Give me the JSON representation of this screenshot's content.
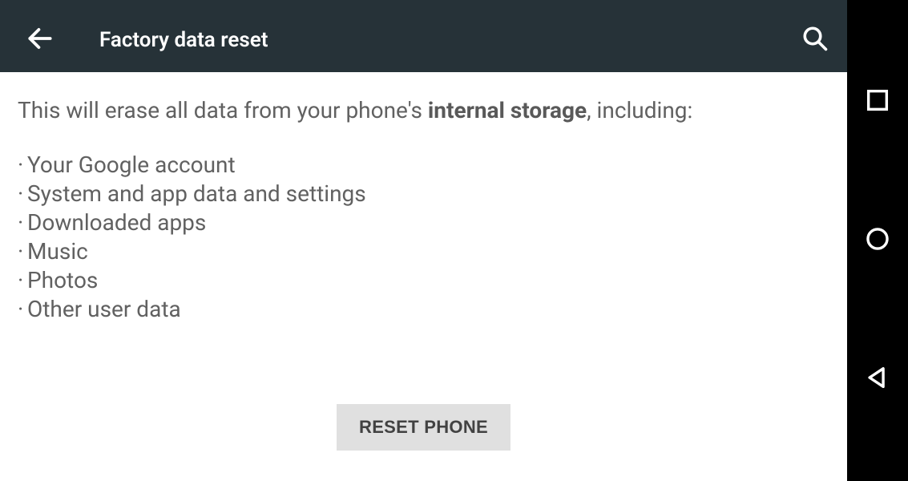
{
  "header": {
    "title": "Factory data reset"
  },
  "body": {
    "lead_pre": "This will erase all data from your phone's ",
    "lead_strong": "internal storage",
    "lead_post": ", including:",
    "items": [
      "Your Google account",
      "System and app data and settings",
      "Downloaded apps",
      "Music",
      "Photos",
      "Other user data"
    ]
  },
  "action": {
    "reset_label": "RESET PHONE"
  },
  "icons": {
    "back": "back-arrow",
    "search": "search",
    "nav_recent": "square",
    "nav_home": "circle",
    "nav_back": "triangle"
  },
  "colors": {
    "appbar_bg": "#263238",
    "body_text": "#616161",
    "button_bg": "#e0e0e0"
  }
}
